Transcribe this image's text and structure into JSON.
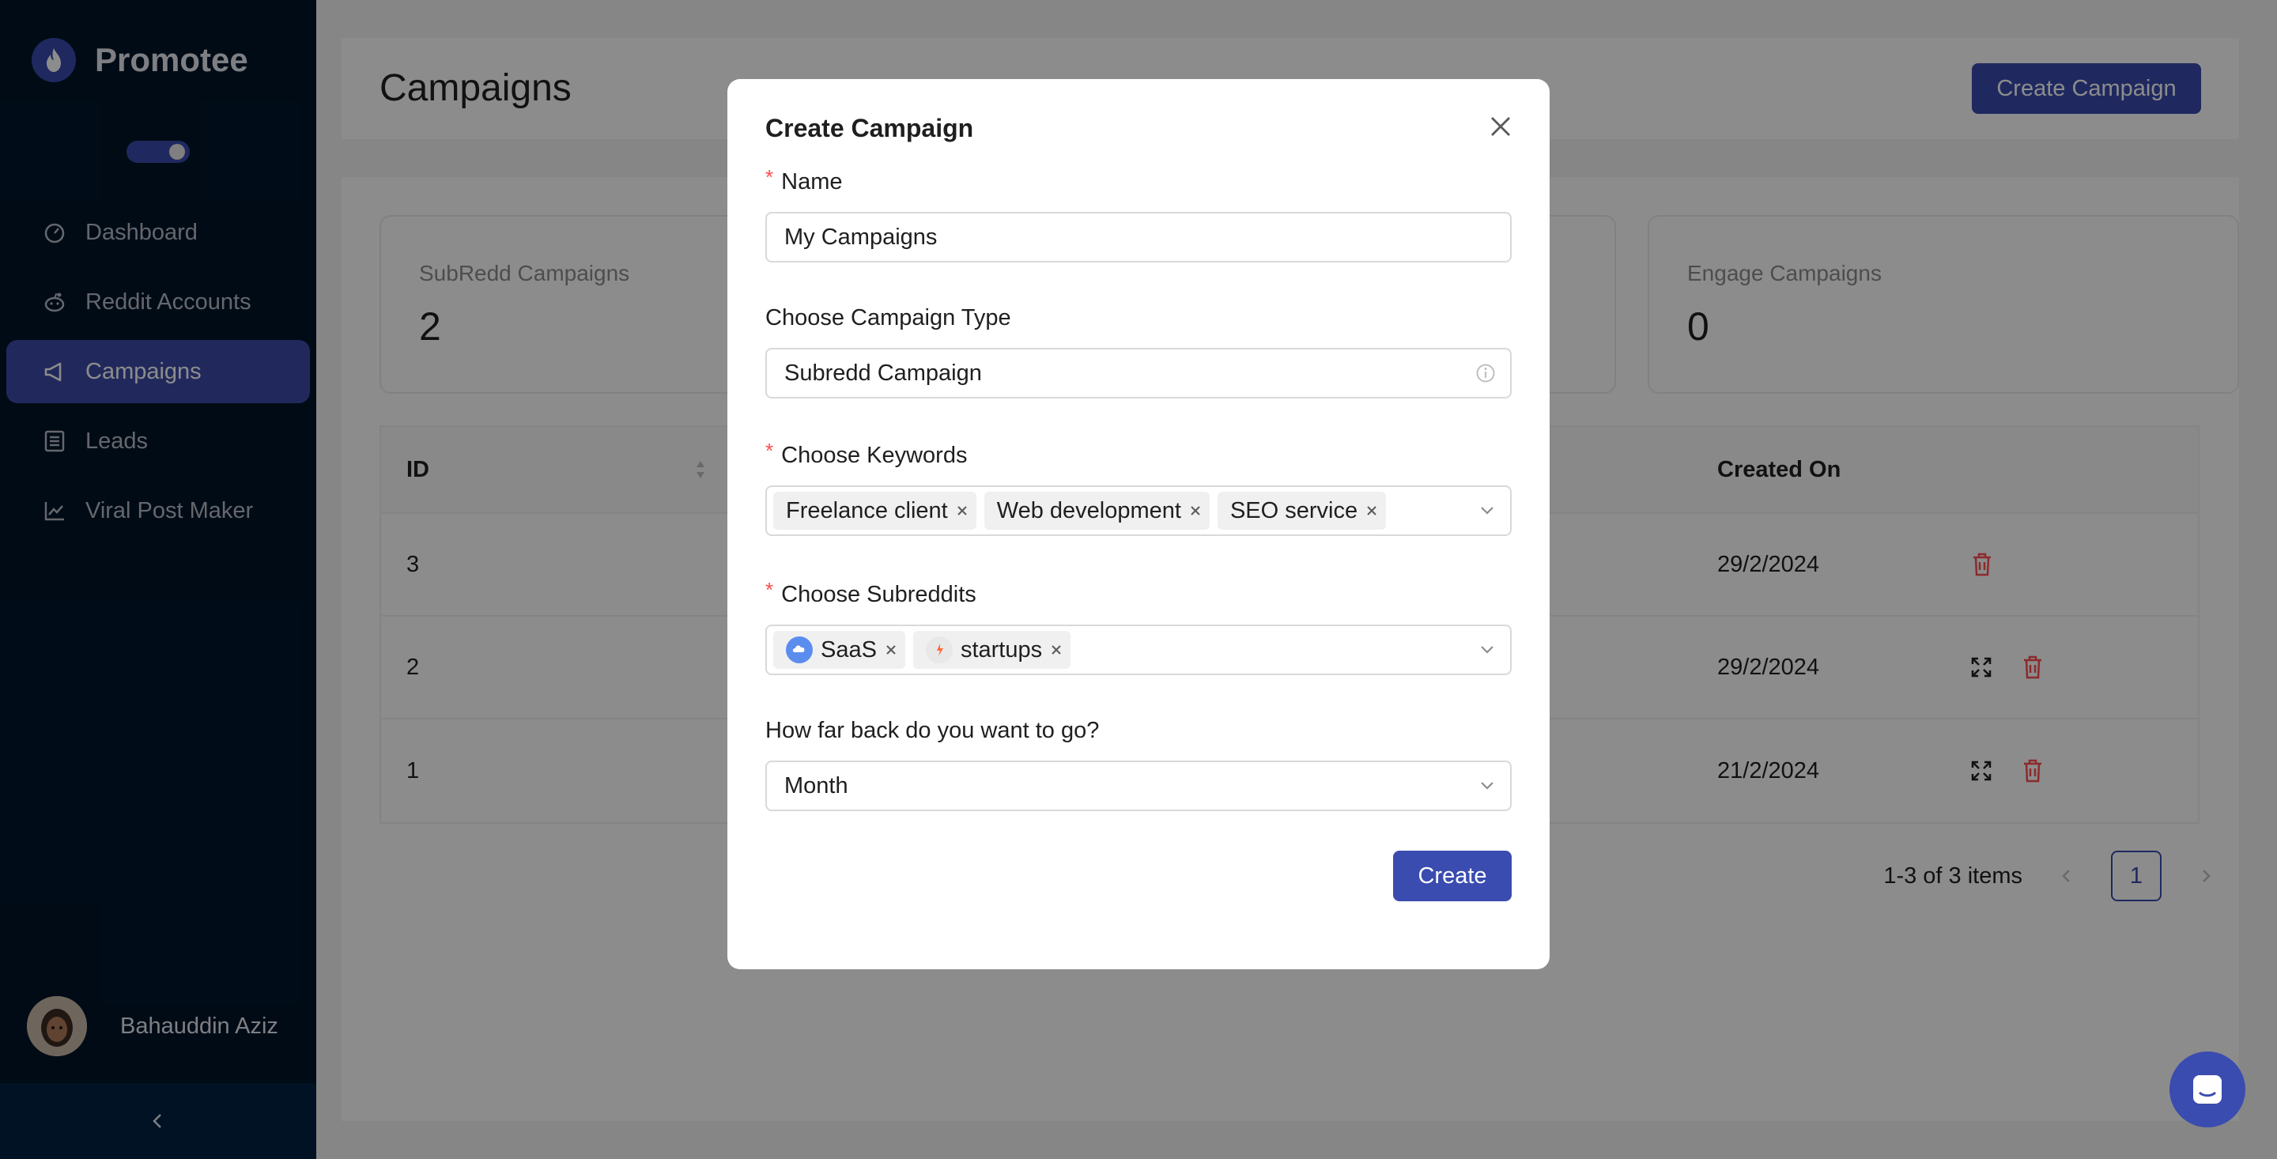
{
  "app": {
    "name": "Promotee",
    "logo_icon": "flame-icon"
  },
  "sidebar": {
    "items": [
      {
        "label": "Dashboard",
        "icon": "dashboard-icon",
        "active": false
      },
      {
        "label": "Reddit Accounts",
        "icon": "reddit-icon",
        "active": false
      },
      {
        "label": "Campaigns",
        "icon": "megaphone-icon",
        "active": true
      },
      {
        "label": "Leads",
        "icon": "list-icon",
        "active": false
      },
      {
        "label": "Viral Post Maker",
        "icon": "chart-line-icon",
        "active": false
      }
    ],
    "user": {
      "name": "Bahauddin Aziz"
    }
  },
  "header": {
    "title": "Campaigns",
    "create_button": "Create Campaign"
  },
  "stats": [
    {
      "label": "SubRedd Campaigns",
      "value": "2"
    },
    {
      "label": "Engage Campaigns",
      "value": "0"
    }
  ],
  "table": {
    "columns": {
      "id": "ID",
      "created_on": "Created On"
    },
    "rows": [
      {
        "id": "3",
        "created_on": "29/2/2024"
      },
      {
        "id": "2",
        "created_on": "29/2/2024"
      },
      {
        "id": "1",
        "created_on": "21/2/2024"
      }
    ]
  },
  "pagination": {
    "summary": "1-3 of 3 items",
    "current_page": "1"
  },
  "modal": {
    "title": "Create Campaign",
    "name": {
      "label": "Name",
      "value": "My Campaigns"
    },
    "campaign_type": {
      "label": "Choose Campaign Type",
      "value": "Subredd Campaign"
    },
    "keywords": {
      "label": "Choose Keywords",
      "tags": [
        "Freelance client",
        "Web development",
        "SEO service"
      ]
    },
    "subreddits": {
      "label": "Choose Subreddits",
      "tags": [
        "SaaS",
        "startups"
      ]
    },
    "time_range": {
      "label": "How far back do you want to go?",
      "value": "Month"
    },
    "create_button": "Create"
  },
  "colors": {
    "sidebar_bg": "#001529",
    "accent": "#3a4caf",
    "danger": "#ff4d4f"
  }
}
